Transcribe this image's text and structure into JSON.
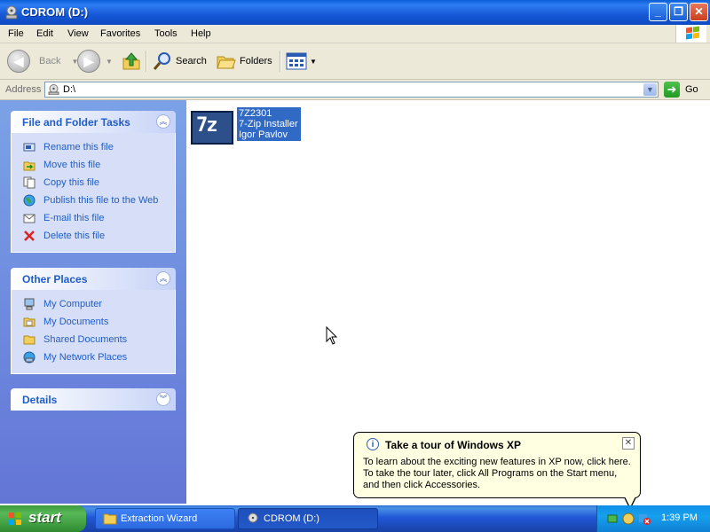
{
  "window": {
    "title": "CDROM (D:)"
  },
  "menu": [
    "File",
    "Edit",
    "View",
    "Favorites",
    "Tools",
    "Help"
  ],
  "toolbar": {
    "back_label": "Back",
    "search_label": "Search",
    "folders_label": "Folders"
  },
  "address": {
    "label": "Address",
    "value": "D:\\",
    "go_label": "Go"
  },
  "panels": {
    "file_tasks": {
      "title": "File and Folder Tasks",
      "items": [
        {
          "label": "Rename this file",
          "icon": "rename-icon"
        },
        {
          "label": "Move this file",
          "icon": "move-icon"
        },
        {
          "label": "Copy this file",
          "icon": "copy-icon"
        },
        {
          "label": "Publish this file to the Web",
          "icon": "globe-icon"
        },
        {
          "label": "E-mail this file",
          "icon": "email-icon"
        },
        {
          "label": "Delete this file",
          "icon": "delete-icon"
        }
      ]
    },
    "other_places": {
      "title": "Other Places",
      "items": [
        {
          "label": "My Computer",
          "icon": "my-computer-icon"
        },
        {
          "label": "My Documents",
          "icon": "folder-icon"
        },
        {
          "label": "Shared Documents",
          "icon": "folder-icon"
        },
        {
          "label": "My Network Places",
          "icon": "network-icon"
        }
      ]
    },
    "details": {
      "title": "Details"
    }
  },
  "file": {
    "icon_text": "7z",
    "line1": "7Z2301",
    "line2": "7-Zip Installer",
    "line3": "Igor Pavlov"
  },
  "balloon": {
    "title": "Take a tour of Windows XP",
    "line1": "To learn about the exciting new features in XP now, click here.",
    "line2": "To take the tour later, click All Programs on the Start menu,",
    "line3": "and then click Accessories."
  },
  "taskbar": {
    "start_label": "start",
    "buttons": [
      {
        "label": "Extraction Wizard"
      },
      {
        "label": "CDROM (D:)"
      }
    ],
    "clock": "1:39 PM"
  }
}
